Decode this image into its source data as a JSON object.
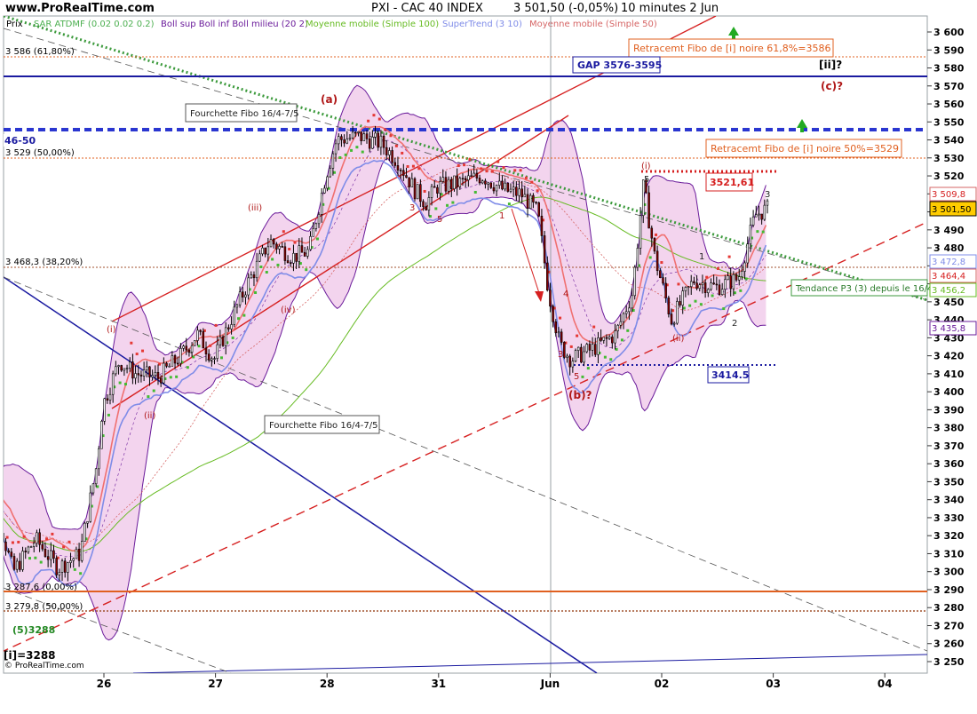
{
  "header": {
    "site": "www.ProRealTime.com",
    "title": "PXI - CAC 40 INDEX",
    "last": "3 501,50 (-0,05%)",
    "period": "10 minutes  2 Jun"
  },
  "legend": {
    "price": "Prix",
    "sar": "SAR ATDMF (0.02 0.02 0.2)",
    "boll": "Boll sup Boll inf Boll milieu (20 2)",
    "ma100": "Moyenne mobile (Simple 100)",
    "supertrend": "SuperTrend (3 10)",
    "ma50": "Moyenne mobile (Simple 50)"
  },
  "colors": {
    "price": "#000000",
    "up_candle": "#ffffff",
    "down_candle": "#8b0000",
    "bollinger": "#6a1b9a",
    "bollinger_fill": "#f3d4ee",
    "sar": "#e53935",
    "ma100": "#66bb22",
    "supertrend": "#7f8ce8",
    "ma50": "#d66666",
    "fibo_line": "#e06020",
    "gap_line": "#1a1aa0",
    "channel": "#d62020"
  },
  "annotations": {
    "fibo_61_label": "3 586 (61,80%)",
    "fibo_50_label": "3 529 (50,00%)",
    "fibo_38_label": "3 468,3 (38,20%)",
    "fibo_0_label": "3 287,6 (0,00%)",
    "fibo_50b_label": "3 279,8 (50,00%)",
    "retr_618_box": "Retracemt Fibo de [i] noire 61,8%=3586",
    "retr_50_box": "Retracemt Fibo de [i] noire 50%=3529",
    "gap_box": "GAP 3576-3595",
    "gap_partial": "46-50",
    "fork_box_1": "Fourchette Fibo 16/4-7/5",
    "fork_box_2": "Fourchette Fibo 16/4-7/5",
    "level_3521": "3521,61",
    "level_3414": "3414.5",
    "trend_box": "Tendance P3 (3) depuis le 16/4",
    "wave_ii_bracket": "[ii]?",
    "wave_c": "(c)?",
    "wave_a": "(a)",
    "wave_b": "(b)?",
    "wave_i": "(i)",
    "wave_ii": "(ii)",
    "wave_iii": "(iii)",
    "wave_iv": "(iv)",
    "wave_5_3288": "(5)3288",
    "wave_i_3288": "[i]=3288",
    "small_3": "3",
    "small_5": "5",
    "small_1": "1",
    "small_2": "2",
    "small_4": "4",
    "small_i": "(i)",
    "small_ii": "(ii)",
    "copyright": "© ProRealTime.com"
  },
  "price_labels": {
    "p3509": "3 509,8",
    "p3501": "3 501,50",
    "p3472": "3 472,8",
    "p3464": "3 464,4",
    "p3456": "3 456,2",
    "p3435": "3 435,8"
  },
  "chart_data": {
    "type": "line",
    "ylim": [
      3245,
      3610
    ],
    "y_ticks": [
      "3 250",
      "3 260",
      "3 270",
      "3 280",
      "3 290",
      "3 300",
      "3 310",
      "3 320",
      "3 330",
      "3 340",
      "3 350",
      "3 360",
      "3 370",
      "3 380",
      "3 390",
      "3 400",
      "3 410",
      "3 420",
      "3 430",
      "3 440",
      "3 450",
      "3 460",
      "3 470",
      "3 480",
      "3 490",
      "3 500",
      "3 510",
      "3 520",
      "3 530",
      "3 540",
      "3 550",
      "3 560",
      "3 570",
      "3 580",
      "3 590",
      "3 600"
    ],
    "x_ticks": [
      "26",
      "27",
      "28",
      "31",
      "Jun",
      "02",
      "03",
      "04"
    ],
    "grid": false,
    "series": [
      {
        "name": "Prix",
        "values": [
          [
            0,
            3344
          ],
          [
            0.2,
            3300
          ],
          [
            0.4,
            3318
          ],
          [
            0.6,
            3302
          ],
          [
            0.8,
            3310
          ],
          [
            0.95,
            3360
          ],
          [
            1.0,
            3392
          ],
          [
            1.15,
            3417
          ],
          [
            1.3,
            3410
          ],
          [
            1.5,
            3408
          ],
          [
            1.7,
            3420
          ],
          [
            1.85,
            3432
          ],
          [
            2.0,
            3418
          ],
          [
            2.15,
            3440
          ],
          [
            2.3,
            3460
          ],
          [
            2.5,
            3484
          ],
          [
            2.7,
            3475
          ],
          [
            2.85,
            3478
          ],
          [
            3.0,
            3520
          ],
          [
            3.1,
            3540
          ],
          [
            3.3,
            3542
          ],
          [
            3.5,
            3538
          ],
          [
            3.65,
            3528
          ],
          [
            3.8,
            3512
          ],
          [
            3.9,
            3505
          ],
          [
            4.0,
            3514
          ],
          [
            4.2,
            3516
          ],
          [
            4.4,
            3520
          ],
          [
            4.6,
            3512
          ],
          [
            4.75,
            3510
          ],
          [
            4.9,
            3500
          ],
          [
            5.0,
            3455
          ],
          [
            5.1,
            3426
          ],
          [
            5.2,
            3418
          ],
          [
            5.4,
            3424
          ],
          [
            5.6,
            3432
          ],
          [
            5.75,
            3455
          ],
          [
            5.85,
            3515
          ],
          [
            5.95,
            3475
          ],
          [
            6.1,
            3440
          ],
          [
            6.3,
            3462
          ],
          [
            6.5,
            3458
          ],
          [
            6.7,
            3463
          ],
          [
            6.85,
            3498
          ],
          [
            6.95,
            3501.5
          ]
        ]
      }
    ]
  }
}
